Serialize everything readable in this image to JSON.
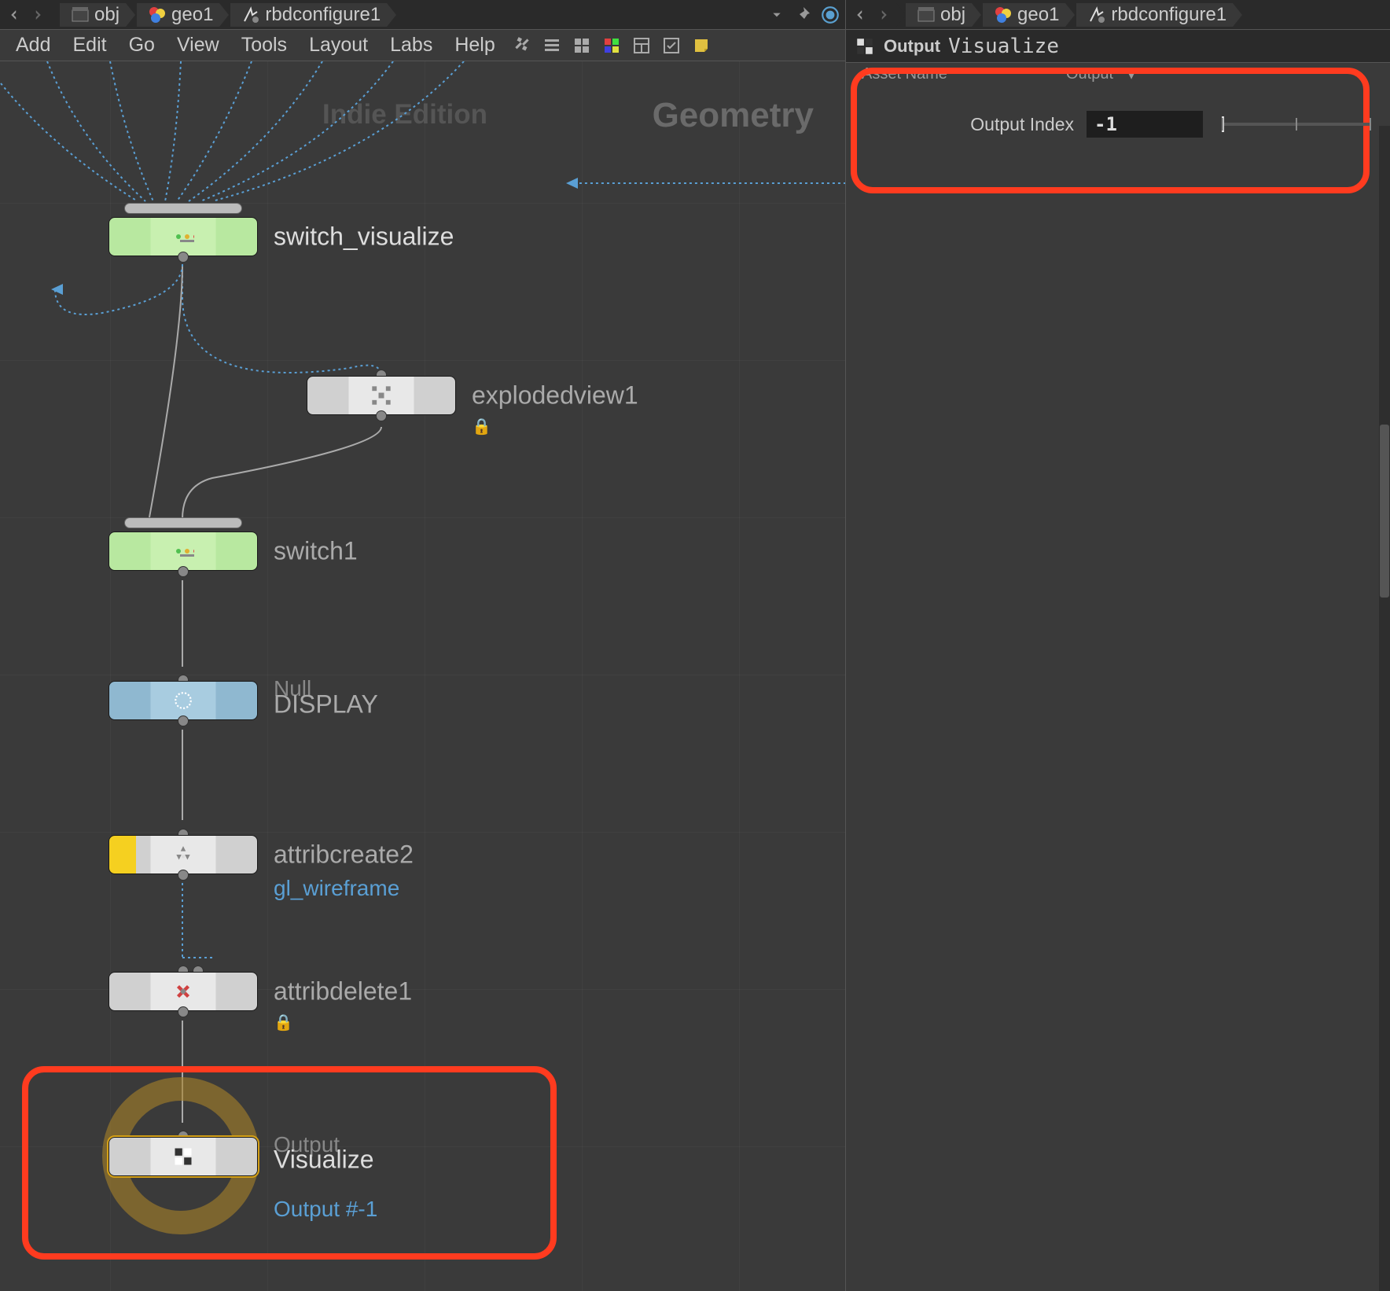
{
  "path_bar": {
    "segments": [
      {
        "icon": "scene-icon",
        "label": "obj"
      },
      {
        "icon": "geo-icon",
        "label": "geo1"
      },
      {
        "icon": "sop-icon",
        "label": "rbdconfigure1"
      }
    ]
  },
  "menu": {
    "items": [
      "Add",
      "Edit",
      "Go",
      "View",
      "Tools",
      "Layout",
      "Labs",
      "Help"
    ]
  },
  "network": {
    "watermark": "Indie Edition",
    "context": "Geometry",
    "nodes": {
      "switch_visualize": {
        "label": "switch_visualize"
      },
      "explodedview1": {
        "label": "explodedview1"
      },
      "switch1": {
        "label": "switch1"
      },
      "display": {
        "type": "Null",
        "label": "DISPLAY"
      },
      "attribcreate2": {
        "label": "attribcreate2",
        "comment": "gl_wireframe"
      },
      "attribdelete1": {
        "label": "attribdelete1"
      },
      "output": {
        "type": "Output",
        "label": "Visualize",
        "comment": "Output #-1"
      }
    }
  },
  "params": {
    "title": "Output",
    "node_name": "Visualize",
    "faded_label_1": "Asset Name",
    "faded_label_2": "Output",
    "output_index": {
      "label": "Output Index",
      "value": "-1"
    }
  }
}
